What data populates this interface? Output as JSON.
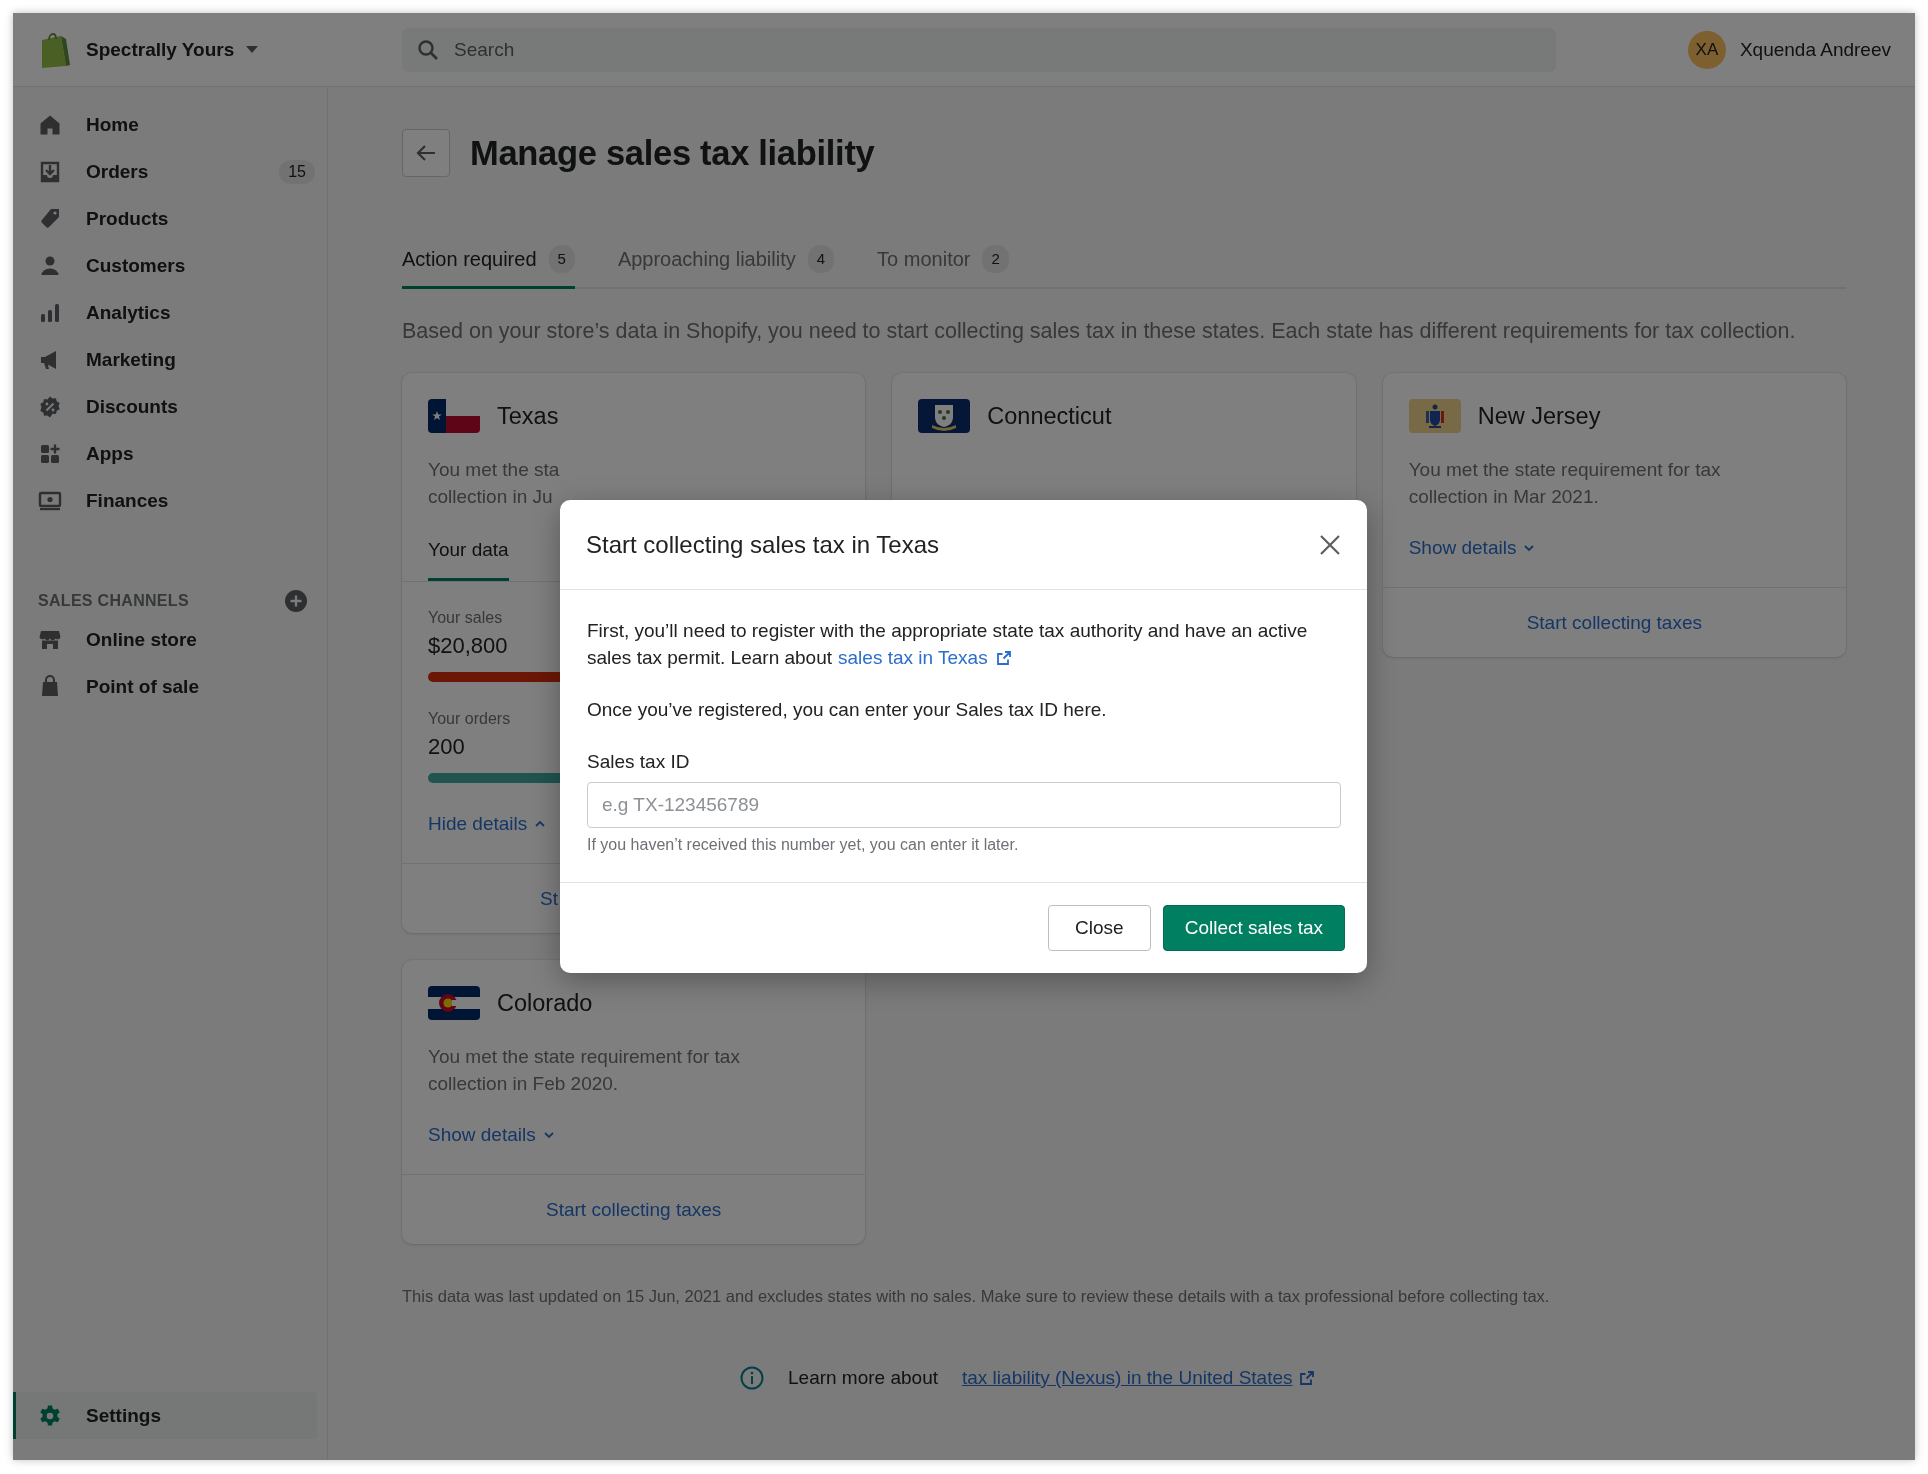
{
  "store": {
    "name": "Spectrally Yours"
  },
  "search": {
    "placeholder": "Search"
  },
  "user": {
    "initials": "XA",
    "name": "Xquenda Andreev"
  },
  "sidebar": {
    "items": [
      {
        "label": "Home",
        "selected": false
      },
      {
        "label": "Orders",
        "badge": "15",
        "selected": false
      },
      {
        "label": "Products",
        "selected": false
      },
      {
        "label": "Customers",
        "selected": false
      },
      {
        "label": "Analytics",
        "selected": false
      },
      {
        "label": "Marketing",
        "selected": false
      },
      {
        "label": "Discounts",
        "selected": false
      },
      {
        "label": "Apps",
        "selected": false
      },
      {
        "label": "Finances",
        "selected": false
      }
    ],
    "section_heading": "SALES CHANNELS",
    "channels": [
      {
        "label": "Online store",
        "selected": false
      },
      {
        "label": "Point of sale",
        "selected": false
      }
    ],
    "settings": {
      "label": "Settings",
      "selected": true
    }
  },
  "page": {
    "title": "Manage sales tax liability",
    "tabs": [
      {
        "label": "Action required",
        "count": "5",
        "selected": true
      },
      {
        "label": "Approaching liability",
        "count": "4",
        "selected": false
      },
      {
        "label": "To monitor",
        "count": "2",
        "selected": false
      }
    ],
    "description": "Based on your store’s data in Shopify, you need to start collecting sales tax in these states. Each state has different requirements for tax collection.",
    "cards": [
      {
        "state": "Texas",
        "kind": "expanded",
        "description_lines": [
          "You met the sta",
          "collection in Ju"
        ],
        "tabs": [
          {
            "label": "Your data",
            "selected": true
          }
        ],
        "metrics": [
          {
            "label": "Your sales",
            "value": "$20,800",
            "kind": "sales"
          },
          {
            "label": "Your orders",
            "value": "200",
            "kind": "orders"
          }
        ],
        "details_link": "Hide details",
        "expanded": true,
        "action": "St"
      },
      {
        "state": "Connecticut",
        "kind": "covered"
      },
      {
        "state": "New Jersey",
        "kind": "collapsed",
        "description_lines": [
          "You met the state requirement for tax",
          "collection in Mar 2021."
        ],
        "details_link": "Show details",
        "expanded": false,
        "action": "Start collecting taxes"
      },
      {
        "state": "Colorado",
        "kind": "collapsed",
        "description_lines": [
          "You met the state requirement for tax",
          "collection in Feb 2020."
        ],
        "details_link": "Show details",
        "expanded": false,
        "action": "Start collecting taxes"
      }
    ],
    "note": "This data was last updated on 15 Jun, 2021 and excludes states with no sales. Make sure to review these details with a tax professional before collecting tax.",
    "learn_more": {
      "text": "Learn more about",
      "link": "tax liability (Nexus) in the United States"
    }
  },
  "modal": {
    "title": "Start collecting sales tax in Texas",
    "paragraph": {
      "text": "First, you’ll need to register with the appropriate state tax authority and have an active sales tax permit. Learn about",
      "link": "sales tax in Texas"
    },
    "paragraph_2": "Once you’ve registered, you can enter your Sales tax ID here.",
    "field": {
      "label": "Sales tax ID",
      "placeholder": "e.g TX-123456789",
      "help": "If you haven’t received this number yet, you can enter it later."
    },
    "buttons": [
      {
        "label": "Close",
        "kind": "secondary"
      },
      {
        "label": "Collect sales tax",
        "kind": "primary"
      }
    ]
  }
}
